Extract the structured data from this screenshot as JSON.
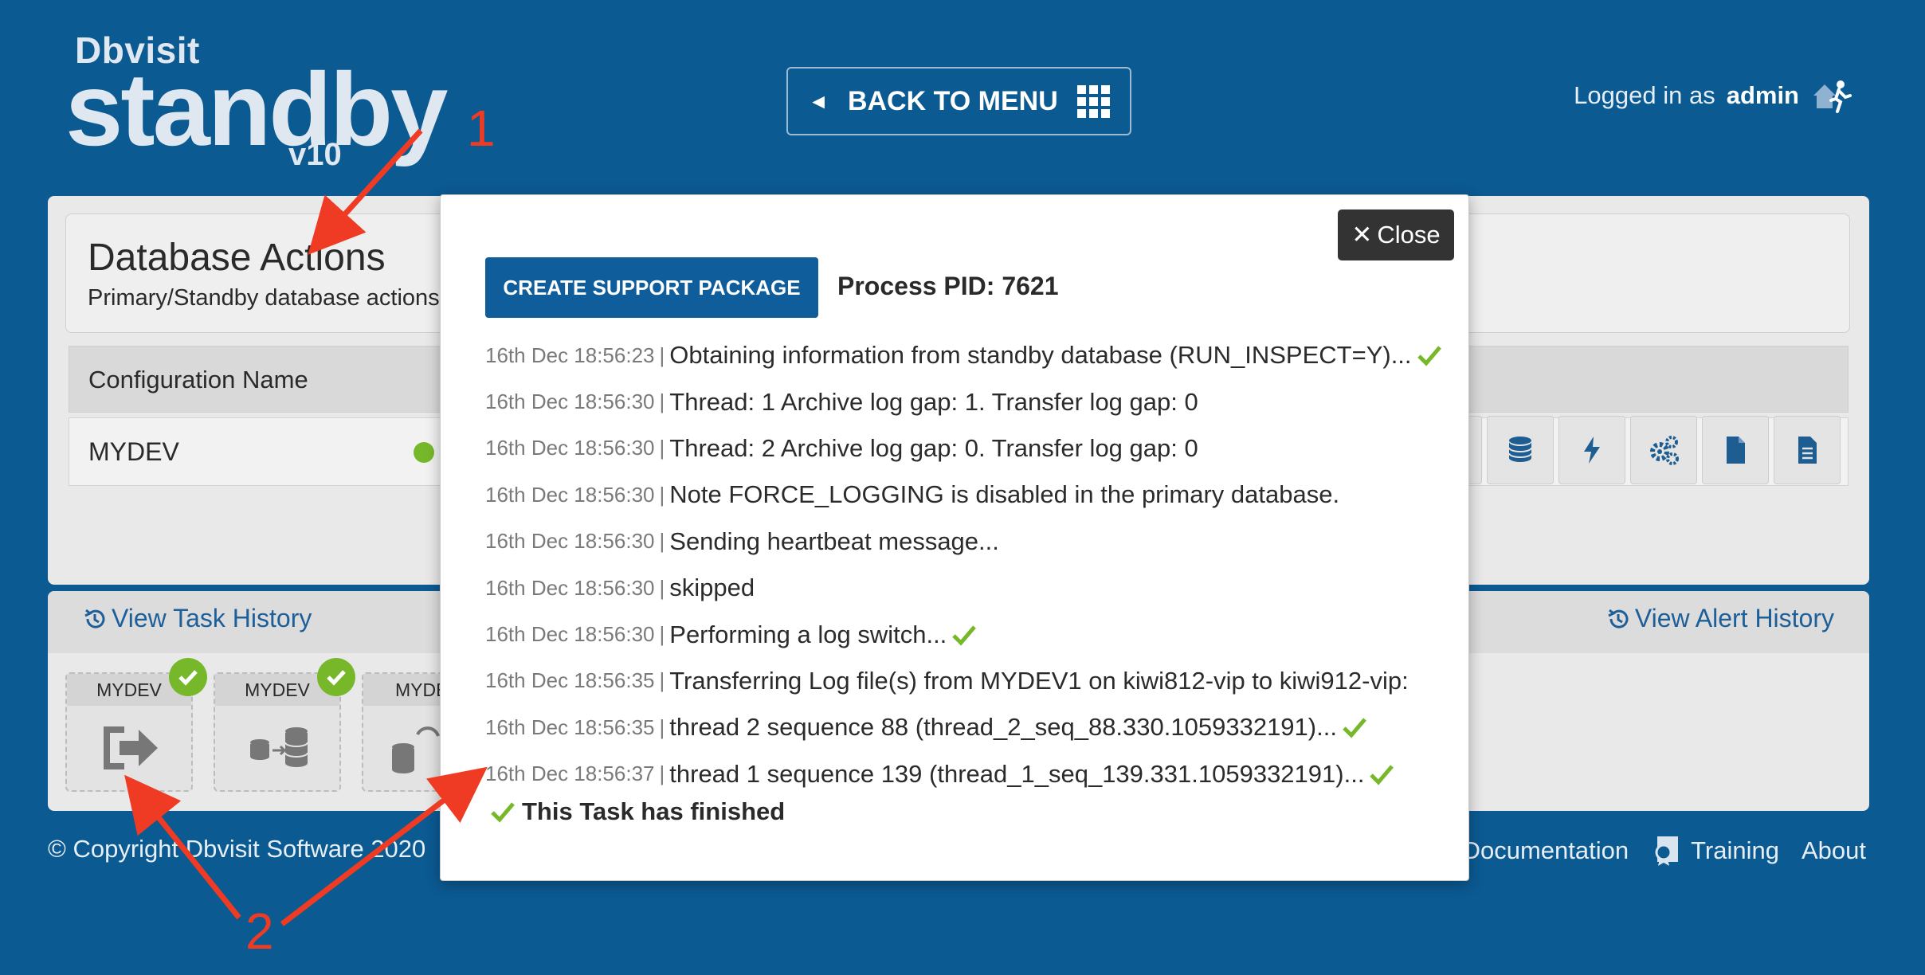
{
  "header": {
    "brand": "Dbvisit",
    "product": "standby",
    "version": "v10",
    "back_button": "BACK TO MENU",
    "logged_in_prefix": "Logged in as",
    "username": "admin"
  },
  "database_actions": {
    "title": "Database Actions",
    "subtitle": "Primary/Standby database actions",
    "table_header": "Configuration Name",
    "rows": [
      {
        "name": "MYDEV",
        "status_color": "#77b82a"
      }
    ],
    "action_icons": [
      "database-icon",
      "database-icon",
      "lightning-icon",
      "gears-icon",
      "document-icon",
      "document-lines-icon"
    ]
  },
  "tasks": {
    "view_task_history": "View Task History",
    "view_alert_history": "View Alert History",
    "cards": [
      {
        "label": "MYDEV",
        "icon": "sign-out-icon",
        "status": "success"
      },
      {
        "label": "MYDEV",
        "icon": "db-transfer-icon",
        "status": "success"
      },
      {
        "label": "MYDE",
        "icon": "db-sync-icon",
        "status": ""
      }
    ]
  },
  "footer": {
    "copyright": "© Copyright Dbvisit Software 2020",
    "links": [
      "Documentation",
      "Training",
      "About"
    ]
  },
  "modal": {
    "close_label": "Close",
    "support_button": "CREATE SUPPORT PACKAGE",
    "pid_text": "Process PID: 7621",
    "log": [
      {
        "ts": "16th Dec 18:56:23",
        "msg": "Obtaining information from standby database (RUN_INSPECT=Y)...",
        "ok": true
      },
      {
        "ts": "16th Dec 18:56:30",
        "msg": "Thread: 1 Archive log gap: 1. Transfer log gap: 0",
        "ok": false
      },
      {
        "ts": "16th Dec 18:56:30",
        "msg": "Thread: 2 Archive log gap: 0. Transfer log gap: 0",
        "ok": false
      },
      {
        "ts": "16th Dec 18:56:30",
        "msg": "Note FORCE_LOGGING is disabled in the primary database.",
        "ok": false
      },
      {
        "ts": "16th Dec 18:56:30",
        "msg": "Sending heartbeat message...",
        "ok": false
      },
      {
        "ts": "16th Dec 18:56:30",
        "msg": "skipped",
        "ok": false
      },
      {
        "ts": "16th Dec 18:56:30",
        "msg": "Performing a log switch...",
        "ok": true
      },
      {
        "ts": "16th Dec 18:56:35",
        "msg": "Transferring Log file(s) from MYDEV1 on kiwi812-vip to kiwi912-vip:",
        "ok": false
      },
      {
        "ts": "16th Dec 18:56:35",
        "msg": "thread 2 sequence 88 (thread_2_seq_88.330.1059332191)...",
        "ok": true
      },
      {
        "ts": "16th Dec 18:56:37",
        "msg": "thread 1 sequence 139 (thread_1_seq_139.331.1059332191)...",
        "ok": true
      }
    ],
    "finished_text": "This Task has finished"
  },
  "annotations": [
    "1",
    "2"
  ],
  "colors": {
    "background": "#0b5a92",
    "accent_green": "#77b82a",
    "button_blue": "#0f5d9b",
    "annotation_red": "#ef3b24"
  }
}
